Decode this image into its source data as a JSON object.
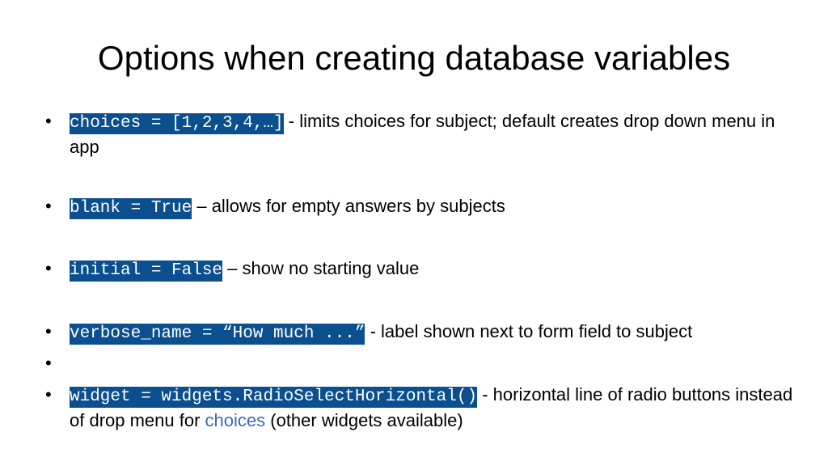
{
  "slide": {
    "title": "Options when creating database variables"
  },
  "bullets": [
    {
      "code": "choices = [1,2,3,4,…]",
      "text": " - limits choices for subject; default creates drop down menu in app"
    },
    {
      "code": "blank = True",
      "text": " – allows for empty answers by subjects"
    },
    {
      "code": "initial = False",
      "text": " – show no starting value"
    },
    {
      "code": "verbose_name = “How much ...”",
      "text": " - label shown next to form field to subject"
    },
    {
      "code": "",
      "text": ""
    },
    {
      "code": "widget = widgets.RadioSelectHorizontal()",
      "text": " - horizontal line of radio buttons instead of drop menu for ",
      "link": "choices",
      "tail": " (other widgets available)"
    }
  ],
  "glyphs": {
    "bullet": "•"
  },
  "colors": {
    "code_background": "#0b4f8e",
    "code_text": "#ffffff",
    "link": "#3a6bb7"
  }
}
